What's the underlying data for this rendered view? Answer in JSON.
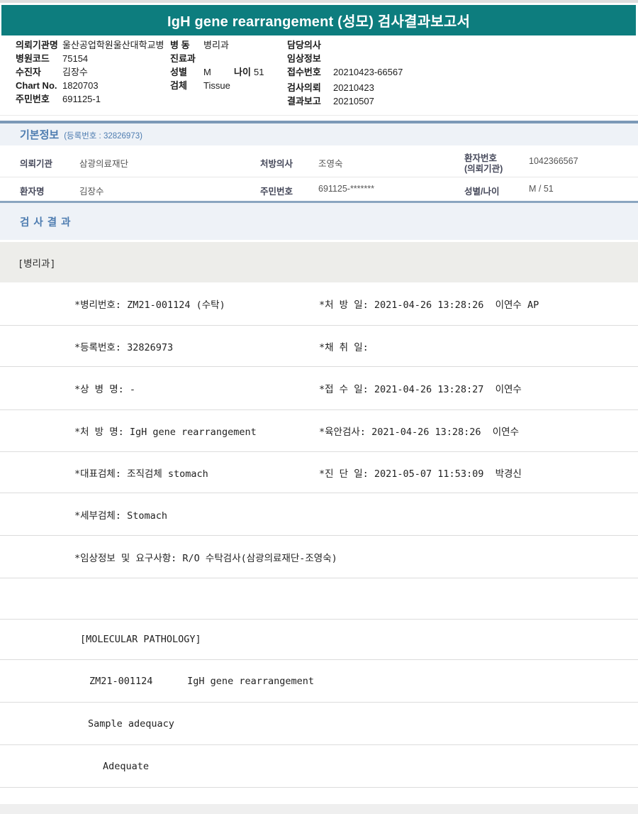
{
  "colors": {
    "accent_teal": "#0d7d7e",
    "section_blue": "#4d7cb0",
    "panel_border_blue": "#7b99b7"
  },
  "title_bar": {
    "title": "IgH gene rearrangement (성모) 검사결과보고서"
  },
  "patient_header": {
    "rows": [
      {
        "l": "의뢰기관명",
        "lv": "울산공업학원울산대학교병",
        "m": "병 동",
        "mv": "병리과",
        "r": "담당의사",
        "rv": ""
      },
      {
        "l": "병원코드",
        "lv": "75154",
        "m": "진료과",
        "mv": "",
        "r": "임상정보",
        "rv": ""
      },
      {
        "l": "수진자",
        "lv": "김장수",
        "m": "성별",
        "mv": "M",
        "m2": "나이",
        "m2v": "51",
        "r": "접수번호",
        "rv": "20210423-66567"
      },
      {
        "l": "Chart No.",
        "lv": "1820703",
        "m": "검체",
        "mv": "Tissue",
        "r": "검사의뢰",
        "rv": "20210423"
      },
      {
        "l": "주민번호",
        "lv": "691125-1",
        "r": "결과보고",
        "rv": "20210507"
      }
    ]
  },
  "basic_info": {
    "section_title": "기본정보",
    "registration_label": "(등록번호 : 32826973)",
    "rows": [
      {
        "c1l": "의뢰기관",
        "c1v": "삼광의료재단",
        "c2l": "처방의사",
        "c2v": "조영숙",
        "c3l": "환자번호",
        "c3l2": "(의뢰기관)",
        "c3v": "1042366567"
      },
      {
        "c1l": "환자명",
        "c1v": "김장수",
        "c2l": "주민번호",
        "c2v": "691125-*******",
        "c3l": "성별/나이",
        "c3v": "M / 51"
      }
    ]
  },
  "results": {
    "section_title": "검 사 결 과",
    "department": "[병리과]",
    "rows": [
      {
        "left": "*병리번호: ZM21-001124 (수탁)",
        "right": "*처 방 일: 2021-04-26 13:28:26  이연수 AP"
      },
      {
        "left": "*등록번호: 32826973",
        "right": "*채 취 일:"
      },
      {
        "left": "*상 병 명: -",
        "right": "*접 수 일: 2021-04-26 13:28:27  이연수"
      },
      {
        "left": "*처 방 명: IgH gene rearrangement",
        "right": "*육안검사: 2021-04-26 13:28:26  이연수"
      },
      {
        "left": "*대표검체: 조직검체 stomach",
        "right": "*진 단 일: 2021-05-07 11:53:09  박경신"
      },
      {
        "left": "*세부검체: Stomach",
        "right": ""
      },
      {
        "left": "*임상정보 및 요구사항: R/O 수탁검사(삼광의료재단-조영숙)",
        "right": ""
      },
      {
        "left": "",
        "right": ""
      },
      {
        "left": "[MOLECULAR PATHOLOGY]",
        "right": ""
      },
      {
        "left": "ZM21-001124      IgH gene rearrangement",
        "right": ""
      },
      {
        "left": "Sample adequacy",
        "right": ""
      },
      {
        "left": "Adequate",
        "right": ""
      }
    ]
  }
}
